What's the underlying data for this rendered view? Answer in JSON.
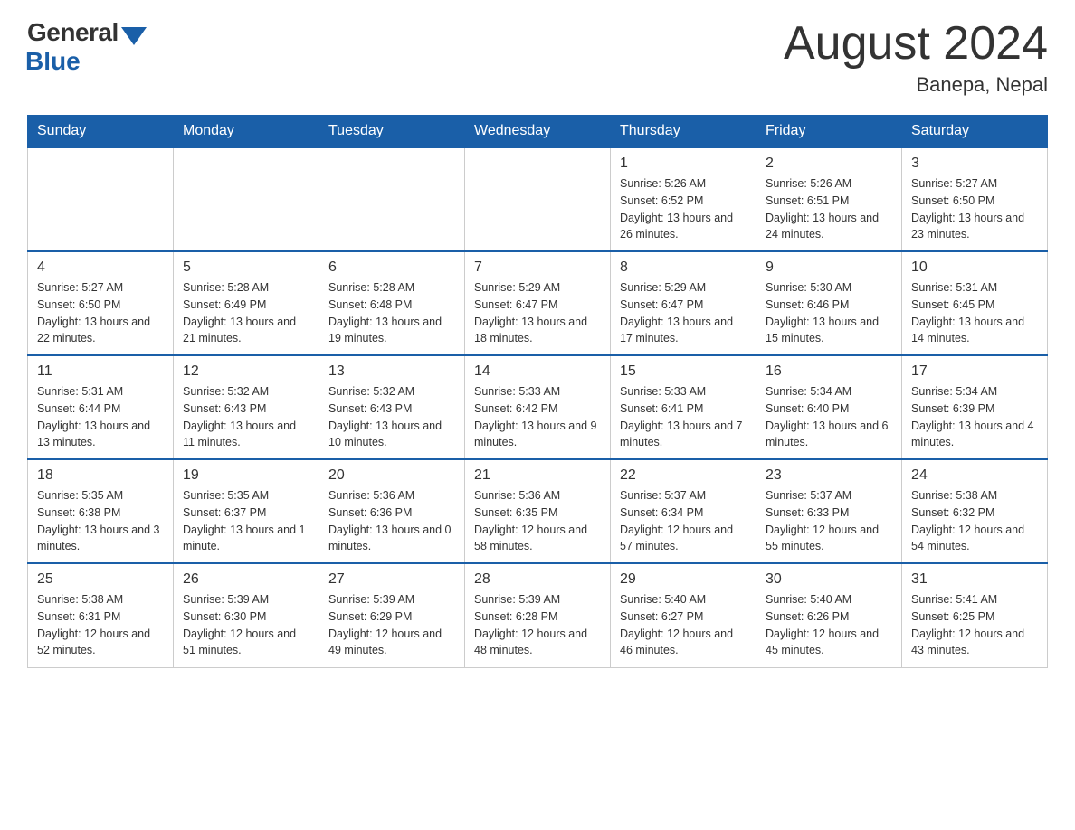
{
  "header": {
    "logo_general": "General",
    "logo_blue": "Blue",
    "title": "August 2024",
    "location": "Banepa, Nepal"
  },
  "calendar": {
    "days_of_week": [
      "Sunday",
      "Monday",
      "Tuesday",
      "Wednesday",
      "Thursday",
      "Friday",
      "Saturday"
    ],
    "weeks": [
      [
        {
          "day": "",
          "info": ""
        },
        {
          "day": "",
          "info": ""
        },
        {
          "day": "",
          "info": ""
        },
        {
          "day": "",
          "info": ""
        },
        {
          "day": "1",
          "info": "Sunrise: 5:26 AM\nSunset: 6:52 PM\nDaylight: 13 hours and 26 minutes."
        },
        {
          "day": "2",
          "info": "Sunrise: 5:26 AM\nSunset: 6:51 PM\nDaylight: 13 hours and 24 minutes."
        },
        {
          "day": "3",
          "info": "Sunrise: 5:27 AM\nSunset: 6:50 PM\nDaylight: 13 hours and 23 minutes."
        }
      ],
      [
        {
          "day": "4",
          "info": "Sunrise: 5:27 AM\nSunset: 6:50 PM\nDaylight: 13 hours and 22 minutes."
        },
        {
          "day": "5",
          "info": "Sunrise: 5:28 AM\nSunset: 6:49 PM\nDaylight: 13 hours and 21 minutes."
        },
        {
          "day": "6",
          "info": "Sunrise: 5:28 AM\nSunset: 6:48 PM\nDaylight: 13 hours and 19 minutes."
        },
        {
          "day": "7",
          "info": "Sunrise: 5:29 AM\nSunset: 6:47 PM\nDaylight: 13 hours and 18 minutes."
        },
        {
          "day": "8",
          "info": "Sunrise: 5:29 AM\nSunset: 6:47 PM\nDaylight: 13 hours and 17 minutes."
        },
        {
          "day": "9",
          "info": "Sunrise: 5:30 AM\nSunset: 6:46 PM\nDaylight: 13 hours and 15 minutes."
        },
        {
          "day": "10",
          "info": "Sunrise: 5:31 AM\nSunset: 6:45 PM\nDaylight: 13 hours and 14 minutes."
        }
      ],
      [
        {
          "day": "11",
          "info": "Sunrise: 5:31 AM\nSunset: 6:44 PM\nDaylight: 13 hours and 13 minutes."
        },
        {
          "day": "12",
          "info": "Sunrise: 5:32 AM\nSunset: 6:43 PM\nDaylight: 13 hours and 11 minutes."
        },
        {
          "day": "13",
          "info": "Sunrise: 5:32 AM\nSunset: 6:43 PM\nDaylight: 13 hours and 10 minutes."
        },
        {
          "day": "14",
          "info": "Sunrise: 5:33 AM\nSunset: 6:42 PM\nDaylight: 13 hours and 9 minutes."
        },
        {
          "day": "15",
          "info": "Sunrise: 5:33 AM\nSunset: 6:41 PM\nDaylight: 13 hours and 7 minutes."
        },
        {
          "day": "16",
          "info": "Sunrise: 5:34 AM\nSunset: 6:40 PM\nDaylight: 13 hours and 6 minutes."
        },
        {
          "day": "17",
          "info": "Sunrise: 5:34 AM\nSunset: 6:39 PM\nDaylight: 13 hours and 4 minutes."
        }
      ],
      [
        {
          "day": "18",
          "info": "Sunrise: 5:35 AM\nSunset: 6:38 PM\nDaylight: 13 hours and 3 minutes."
        },
        {
          "day": "19",
          "info": "Sunrise: 5:35 AM\nSunset: 6:37 PM\nDaylight: 13 hours and 1 minute."
        },
        {
          "day": "20",
          "info": "Sunrise: 5:36 AM\nSunset: 6:36 PM\nDaylight: 13 hours and 0 minutes."
        },
        {
          "day": "21",
          "info": "Sunrise: 5:36 AM\nSunset: 6:35 PM\nDaylight: 12 hours and 58 minutes."
        },
        {
          "day": "22",
          "info": "Sunrise: 5:37 AM\nSunset: 6:34 PM\nDaylight: 12 hours and 57 minutes."
        },
        {
          "day": "23",
          "info": "Sunrise: 5:37 AM\nSunset: 6:33 PM\nDaylight: 12 hours and 55 minutes."
        },
        {
          "day": "24",
          "info": "Sunrise: 5:38 AM\nSunset: 6:32 PM\nDaylight: 12 hours and 54 minutes."
        }
      ],
      [
        {
          "day": "25",
          "info": "Sunrise: 5:38 AM\nSunset: 6:31 PM\nDaylight: 12 hours and 52 minutes."
        },
        {
          "day": "26",
          "info": "Sunrise: 5:39 AM\nSunset: 6:30 PM\nDaylight: 12 hours and 51 minutes."
        },
        {
          "day": "27",
          "info": "Sunrise: 5:39 AM\nSunset: 6:29 PM\nDaylight: 12 hours and 49 minutes."
        },
        {
          "day": "28",
          "info": "Sunrise: 5:39 AM\nSunset: 6:28 PM\nDaylight: 12 hours and 48 minutes."
        },
        {
          "day": "29",
          "info": "Sunrise: 5:40 AM\nSunset: 6:27 PM\nDaylight: 12 hours and 46 minutes."
        },
        {
          "day": "30",
          "info": "Sunrise: 5:40 AM\nSunset: 6:26 PM\nDaylight: 12 hours and 45 minutes."
        },
        {
          "day": "31",
          "info": "Sunrise: 5:41 AM\nSunset: 6:25 PM\nDaylight: 12 hours and 43 minutes."
        }
      ]
    ]
  }
}
